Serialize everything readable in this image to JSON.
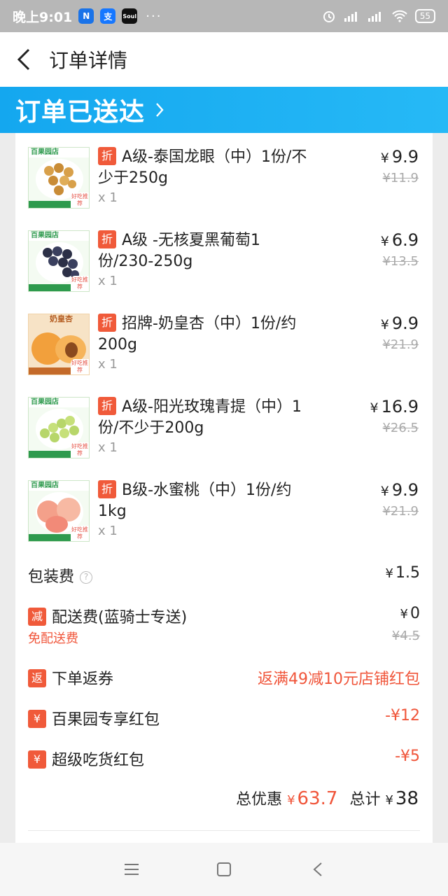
{
  "status_bar": {
    "time": "晚上9:01",
    "apps": [
      {
        "name": "N",
        "color": "#1a73e8"
      },
      {
        "name": "支",
        "color": "#1677ff"
      },
      {
        "name": "Soul",
        "color": "#111111"
      }
    ],
    "more": "···",
    "battery": "55"
  },
  "header": {
    "title": "订单详情"
  },
  "banner": {
    "title": "订单已送达",
    "color": "#1aaaf0"
  },
  "items": [
    {
      "badge": "折",
      "name": "A级-泰国龙眼（中）1份/不少于250g",
      "qty": "x 1",
      "price": "9.9",
      "original": "¥11.9",
      "thumb_label": "百果园店",
      "thumb_tag": "好吃推荐"
    },
    {
      "badge": "折",
      "name": "A级 -无核夏黑葡萄1份/230-250g",
      "qty": "x 1",
      "price": "6.9",
      "original": "¥13.5",
      "thumb_label": "百果园店",
      "thumb_tag": "好吃推荐"
    },
    {
      "badge": "折",
      "name": "招牌-奶皇杏（中）1份/约200g",
      "qty": "x 1",
      "price": "9.9",
      "original": "¥21.9",
      "thumb_label": "奶皇杏",
      "thumb_tag": "好吃推荐"
    },
    {
      "badge": "折",
      "name": "A级-阳光玫瑰青提（中）1份/不少于200g",
      "qty": "x 1",
      "price": "16.9",
      "original": "¥26.5",
      "thumb_label": "百果园店",
      "thumb_tag": "好吃推荐"
    },
    {
      "badge": "折",
      "name": "B级-水蜜桃（中）1份/约1kg",
      "qty": "x 1",
      "price": "9.9",
      "original": "¥21.9",
      "thumb_label": "百果园店",
      "thumb_tag": "好吃推荐"
    }
  ],
  "fees": {
    "packing": {
      "label": "包装费",
      "help": "?",
      "amount": "1.5"
    },
    "delivery": {
      "badge": "减",
      "label": "配送费(蓝骑士专送)",
      "sub": "免配送费",
      "amount": "0",
      "original": "¥4.5"
    }
  },
  "promos": [
    {
      "badge": "返",
      "label": "下单返券",
      "value": "返满49减10元店铺红包"
    },
    {
      "badge": "¥",
      "label": "百果园专享红包",
      "value": "-¥12"
    },
    {
      "badge": "¥",
      "label": "超级吃货红包",
      "value": "-¥5"
    }
  ],
  "summary": {
    "discount_label": "总优惠",
    "discount": "63.7",
    "total_label": "总计",
    "total": "38"
  },
  "bottom_nav": [
    "menu-icon",
    "home-icon",
    "back-icon"
  ]
}
